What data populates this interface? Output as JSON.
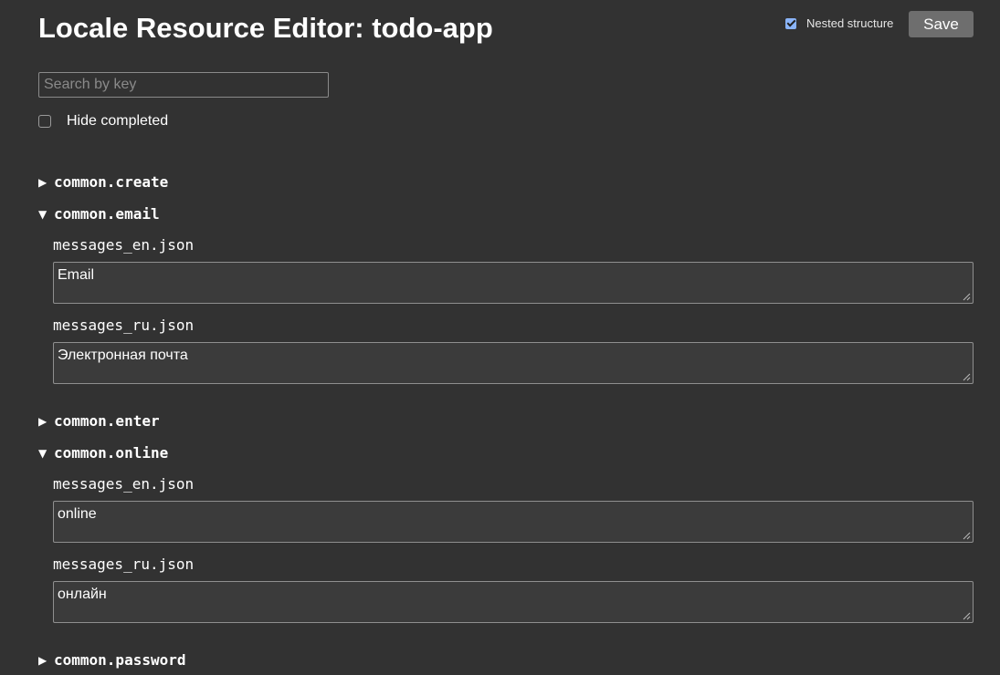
{
  "header": {
    "title": "Locale Resource Editor: todo-app",
    "nested_label": "Nested structure",
    "nested_checked": true,
    "save_label": "Save"
  },
  "search": {
    "placeholder": "Search by key",
    "value": ""
  },
  "filters": {
    "hide_completed_label": "Hide completed",
    "hide_completed_checked": false
  },
  "sections": [
    {
      "key": "common.create",
      "expanded": false,
      "arrow": "▶"
    },
    {
      "key": "common.email",
      "expanded": true,
      "arrow": "▼",
      "entries": [
        {
          "file": "messages_en.json",
          "value": "Email"
        },
        {
          "file": "messages_ru.json",
          "value": "Электронная почта"
        }
      ]
    },
    {
      "key": "common.enter",
      "expanded": false,
      "arrow": "▶"
    },
    {
      "key": "common.online",
      "expanded": true,
      "arrow": "▼",
      "entries": [
        {
          "file": "messages_en.json",
          "value": "online"
        },
        {
          "file": "messages_ru.json",
          "value": "онлайн"
        }
      ]
    },
    {
      "key": "common.password",
      "expanded": false,
      "arrow": "▶"
    }
  ],
  "colors": {
    "background": "#323232",
    "checkbox_accent": "#8ab4f8",
    "button": "#6e6e6e"
  }
}
